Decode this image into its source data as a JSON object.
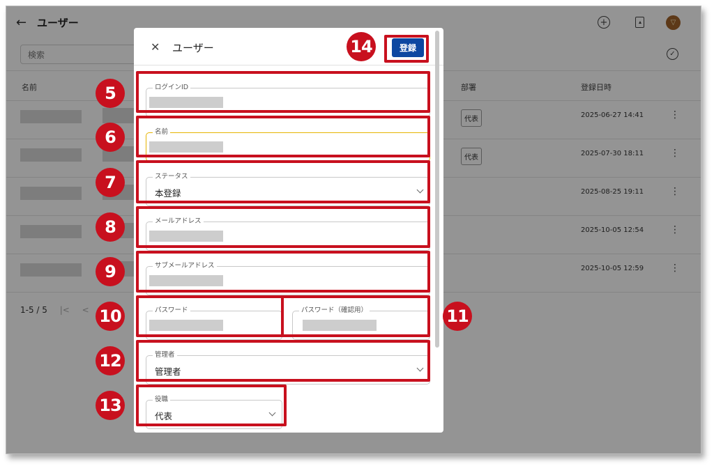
{
  "app": {
    "title": "ユーザー",
    "search_placeholder": "検索",
    "columns": {
      "name": "名前",
      "department": "部署",
      "registered_at": "登録日時"
    },
    "rows": [
      {
        "department": "代表",
        "date": "2025-06-27 14:41"
      },
      {
        "department": "代表",
        "date": "2025-07-30 18:11"
      },
      {
        "department": "",
        "date": "2025-08-25 19:11"
      },
      {
        "department": "",
        "date": "2025-10-05 12:54"
      },
      {
        "department": "",
        "date": "2025-10-05 12:59"
      }
    ],
    "pagination": "1-5 / 5",
    "pager_first": "|<",
    "pager_prev": "<"
  },
  "dialog": {
    "close": "✕",
    "title": "ユーザー",
    "submit": "登録",
    "fields": {
      "login_id": {
        "label": "ログインID"
      },
      "name": {
        "label": "名前"
      },
      "status": {
        "label": "ステータス",
        "value": "本登録"
      },
      "email": {
        "label": "メールアドレス"
      },
      "sub_email": {
        "label": "サブメールアドレス"
      },
      "password": {
        "label": "パスワード"
      },
      "password_confirm": {
        "label": "パスワード（確認用）"
      },
      "admin": {
        "label": "管理者",
        "value": "管理者"
      },
      "position": {
        "label": "役職",
        "value": "代表"
      }
    }
  },
  "annotations": {
    "b5": "5",
    "b6": "6",
    "b7": "7",
    "b8": "8",
    "b9": "9",
    "b10": "10",
    "b11": "11",
    "b12": "12",
    "b13": "13",
    "b14": "14",
    "color": "#c8101e"
  },
  "icons": {
    "back": "←",
    "add": "+",
    "more": "⋮",
    "check": "✓",
    "avatar": "▽"
  }
}
